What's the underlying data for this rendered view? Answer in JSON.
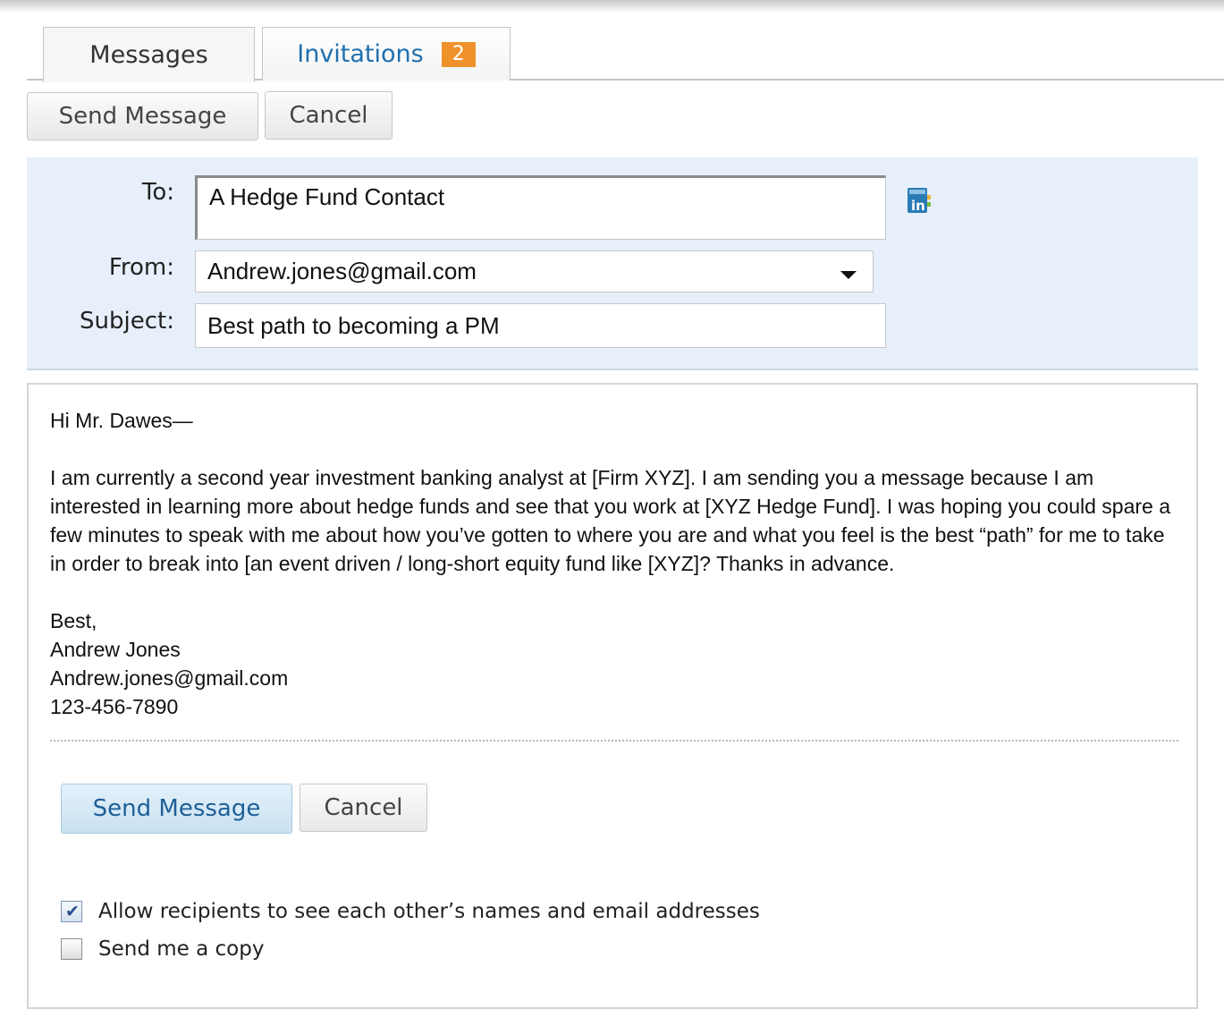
{
  "tabs": {
    "messages_label": "Messages",
    "invitations_label": "Invitations",
    "invitations_badge": "2"
  },
  "toolbar": {
    "send_label": "Send Message",
    "cancel_label": "Cancel"
  },
  "header": {
    "to_label": "To:",
    "to_value": "A Hedge Fund Contact",
    "from_label": "From:",
    "from_value": "Andrew.jones@gmail.com",
    "subject_label": "Subject:",
    "subject_value": "Best path to becoming a PM",
    "address_book_icon": "linkedin-address-book-icon"
  },
  "body": {
    "greeting": "Hi Mr. Dawes—",
    "paragraph": "I am currently a second year investment banking analyst at [Firm XYZ]. I am sending you a message because I am interested in learning more about hedge funds and see that you work at [XYZ Hedge Fund].  I was hoping you could spare a few minutes to speak with me about how you’ve gotten to where you are and what you feel is the best “path” for me to take in order to break into [an event driven / long-short equity fund like [XYZ]? Thanks in advance.",
    "signoff": "Best,",
    "name": "Andrew Jones",
    "email": "Andrew.jones@gmail.com",
    "phone": "123-456-7890"
  },
  "footer": {
    "send_label": "Send Message",
    "cancel_label": "Cancel",
    "allow_recipients_label": "Allow recipients to see each other’s names and email addresses",
    "allow_recipients_checked": true,
    "send_copy_label": "Send me a copy",
    "send_copy_checked": false
  },
  "colors": {
    "header_bg": "#e7f0fa",
    "link_blue": "#1f6fae",
    "badge_orange": "#f0922b",
    "primary_button_bg": "#c8e1f1"
  }
}
